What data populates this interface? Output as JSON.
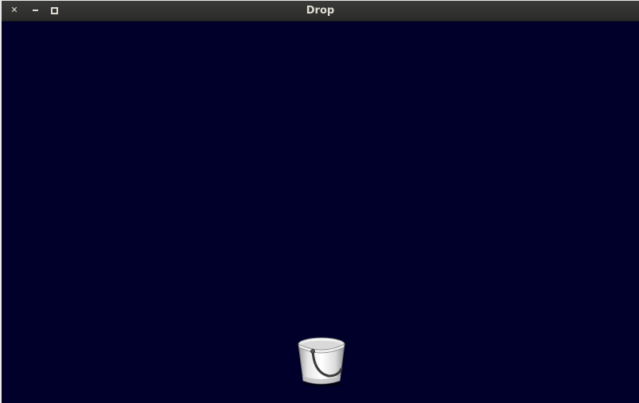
{
  "window": {
    "title": "Drop",
    "controls": {
      "close_icon": "close-icon",
      "minimize_icon": "minimize-icon",
      "maximize_icon": "maximize-icon"
    }
  },
  "game": {
    "background_color": "#00002a",
    "player": {
      "icon": "bucket-icon"
    }
  }
}
